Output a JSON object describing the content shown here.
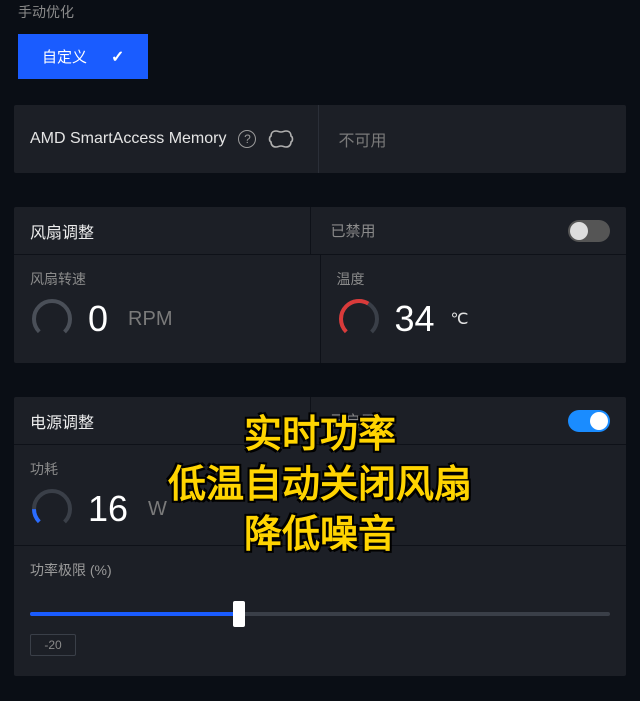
{
  "header": {
    "manual_optimize_label": "手动优化",
    "custom_button_label": "自定义"
  },
  "sam": {
    "title": "AMD SmartAccess Memory",
    "status": "不可用"
  },
  "fan": {
    "title": "风扇调整",
    "status": "已禁用",
    "toggle_on": false,
    "speed_label": "风扇转速",
    "speed_value": "0",
    "speed_unit": "RPM",
    "temp_label": "温度",
    "temp_value": "34",
    "temp_unit": "℃"
  },
  "power": {
    "title": "电源调整",
    "status": "已启用",
    "toggle_on": true,
    "consumption_label": "功耗",
    "consumption_value": "16",
    "consumption_unit": "W",
    "limit_label": "功率极限 (%)",
    "limit_value": "-20",
    "limit_percent": 36
  },
  "overlay": {
    "line1": "实时功率",
    "line2": "低温自动关闭风扇",
    "line3": "降低噪音"
  },
  "icons": {
    "check": "check-icon",
    "help": "help-circle-icon",
    "brain": "brain-icon"
  },
  "colors": {
    "accent_blue": "#1a5cff",
    "toggle_blue": "#1a8cff",
    "gauge_red": "#d93a3a",
    "gauge_blue": "#2a6cff",
    "overlay_text": "#ffd400",
    "panel_bg": "#1c1f26",
    "page_bg": "#0a0e15"
  }
}
